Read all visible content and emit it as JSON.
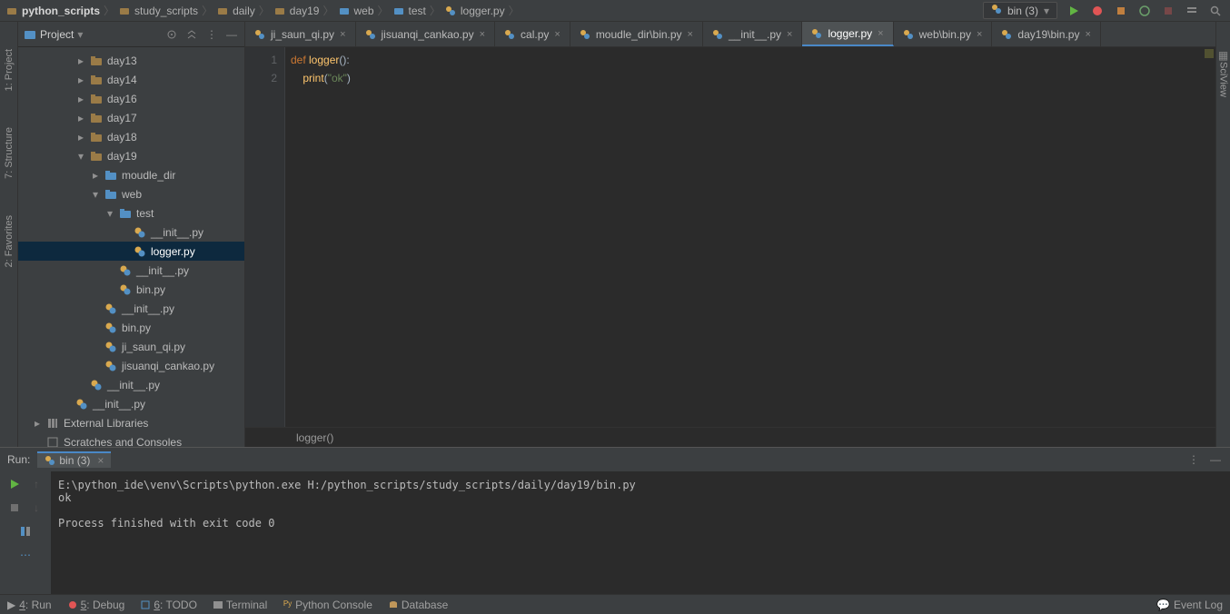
{
  "breadcrumbs": [
    "python_scripts",
    "study_scripts",
    "daily",
    "day19",
    "web",
    "test",
    "logger.py"
  ],
  "runConfig": "bin (3)",
  "projectLabel": "Project",
  "tree": [
    {
      "indent": 4,
      "label": "day13",
      "type": "folder",
      "arrow": "▸"
    },
    {
      "indent": 4,
      "label": "day14",
      "type": "folder",
      "arrow": "▸"
    },
    {
      "indent": 4,
      "label": "day16",
      "type": "folder",
      "arrow": "▸"
    },
    {
      "indent": 4,
      "label": "day17",
      "type": "folder",
      "arrow": "▸"
    },
    {
      "indent": 4,
      "label": "day18",
      "type": "folder",
      "arrow": "▸"
    },
    {
      "indent": 4,
      "label": "day19",
      "type": "folder",
      "arrow": "▾"
    },
    {
      "indent": 5,
      "label": "moudle_dir",
      "type": "pkg",
      "arrow": "▸"
    },
    {
      "indent": 5,
      "label": "web",
      "type": "pkg",
      "arrow": "▾"
    },
    {
      "indent": 6,
      "label": "test",
      "type": "pkg",
      "arrow": "▾"
    },
    {
      "indent": 7,
      "label": "__init__.py",
      "type": "py",
      "arrow": ""
    },
    {
      "indent": 7,
      "label": "logger.py",
      "type": "py",
      "arrow": "",
      "selected": true
    },
    {
      "indent": 6,
      "label": "__init__.py",
      "type": "py",
      "arrow": ""
    },
    {
      "indent": 6,
      "label": "bin.py",
      "type": "py",
      "arrow": ""
    },
    {
      "indent": 5,
      "label": "__init__.py",
      "type": "py",
      "arrow": ""
    },
    {
      "indent": 5,
      "label": "bin.py",
      "type": "py",
      "arrow": ""
    },
    {
      "indent": 5,
      "label": "ji_saun_qi.py",
      "type": "py",
      "arrow": ""
    },
    {
      "indent": 5,
      "label": "jisuanqi_cankao.py",
      "type": "py",
      "arrow": ""
    },
    {
      "indent": 4,
      "label": "__init__.py",
      "type": "py",
      "arrow": ""
    },
    {
      "indent": 3,
      "label": "__init__.py",
      "type": "py",
      "arrow": ""
    },
    {
      "indent": 1,
      "label": "External Libraries",
      "type": "lib",
      "arrow": "▸"
    },
    {
      "indent": 1,
      "label": "Scratches and Consoles",
      "type": "scratch",
      "arrow": ""
    }
  ],
  "tabs": [
    {
      "label": "ji_saun_qi.py"
    },
    {
      "label": "jisuanqi_cankao.py"
    },
    {
      "label": "cal.py"
    },
    {
      "label": "moudle_dir\\bin.py"
    },
    {
      "label": "__init__.py"
    },
    {
      "label": "logger.py",
      "active": true
    },
    {
      "label": "web\\bin.py"
    },
    {
      "label": "day19\\bin.py"
    }
  ],
  "code": {
    "lines": [
      {
        "n": "1",
        "html": "<span class='kw'>def </span><span class='fn'>logger</span><span class='paren'>():</span>"
      },
      {
        "n": "2",
        "html": "    <span class='fn'>print</span><span class='paren'>(</span><span class='str'>\"ok\"</span><span class='paren'>)</span>",
        "hl": true
      }
    ],
    "crumb": "logger()"
  },
  "run": {
    "title": "Run:",
    "config": "bin (3)",
    "output": "E:\\python_ide\\venv\\Scripts\\python.exe H:/python_scripts/study_scripts/daily/day19/bin.py\nok\n\nProcess finished with exit code 0"
  },
  "bottom": {
    "run": "4: Run",
    "debug": "5: Debug",
    "todo": "6: TODO",
    "terminal": "Terminal",
    "pyconsole": "Python Console",
    "database": "Database",
    "eventlog": "Event Log"
  },
  "leftRail": [
    "1: Project",
    "7: Structure",
    "2: Favorites"
  ],
  "rightRail": "SciView"
}
